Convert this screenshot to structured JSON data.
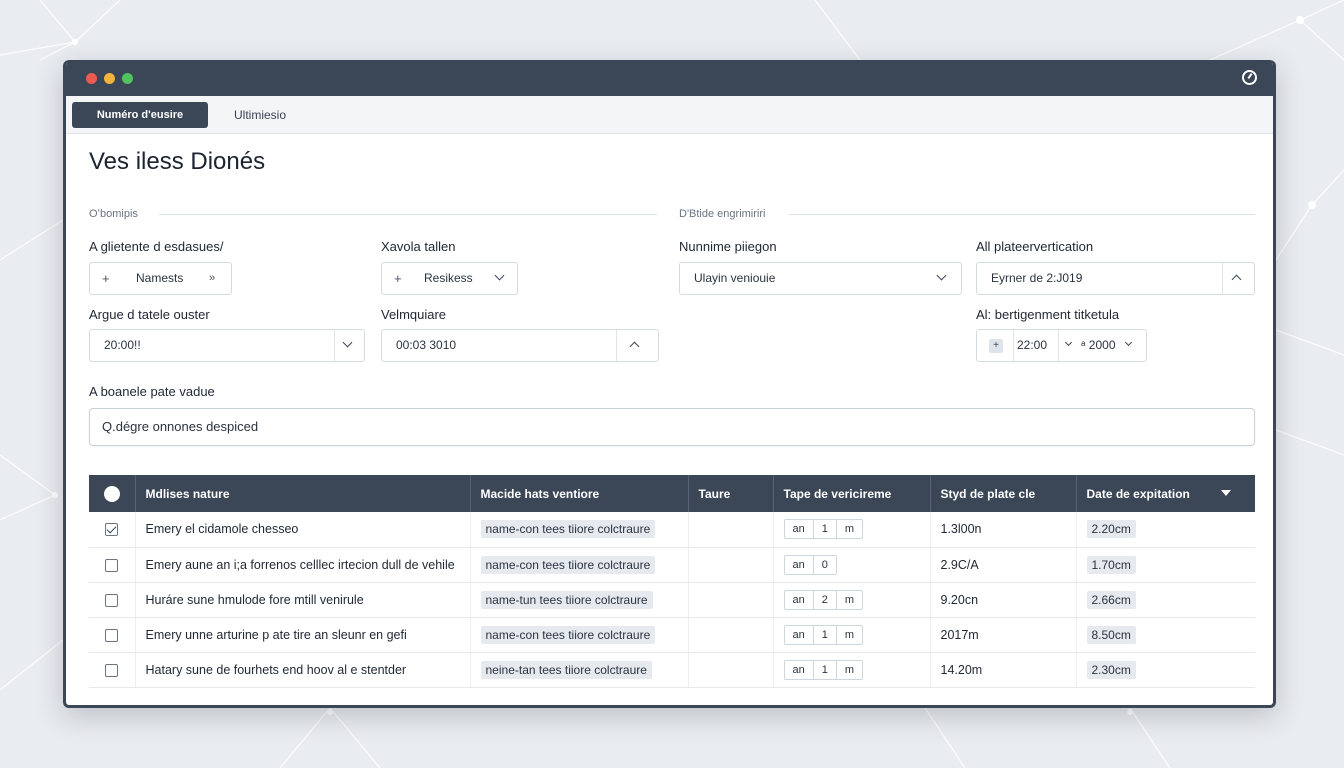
{
  "tabs": [
    {
      "label": "Numéro d'eusire",
      "active": true
    },
    {
      "label": "Ultimiesio",
      "active": false
    }
  ],
  "page_title": "Ves iless Dionés",
  "sections": {
    "left": "Oʻbomipis",
    "right": "D'Btide engrimiriri"
  },
  "fields": {
    "f1": {
      "label": "A glietente d esdasues/",
      "value": "Namests",
      "prefix": "+",
      "suffix": "»"
    },
    "f2": {
      "label": "Xavola tallen",
      "value": "Resikess",
      "prefix": "+"
    },
    "f3": {
      "label": "Nunnime piiegon",
      "value": "Ulayin veniouie"
    },
    "f4": {
      "label": "All plateervertication",
      "value": "Eyrner de 2:J019"
    },
    "f5": {
      "label": "Argue d tatele ouster",
      "value": "20:00!!"
    },
    "f6": {
      "label": "Velmquiare",
      "value": "00:03 3010"
    },
    "f7": {
      "label": "Al: bertigenment titketula",
      "value_a": "22:00",
      "value_b": "ᵃ 2000",
      "prefix": "+"
    }
  },
  "wide": {
    "label": "A boanele pate vadue",
    "value": "Q.dégre onnones despiced"
  },
  "table": {
    "columns": [
      "Mdlises nature",
      "Macide hats ventiore",
      "Taure",
      "Tape de vericireme",
      "Styd de plate cle",
      "Date de expitation"
    ],
    "rows": [
      {
        "checked": true,
        "name": "Emery el cidamole chesseo",
        "desc": "name-con tees tiiore colctraure",
        "step": [
          "an",
          "1",
          "m"
        ],
        "v1": "1.3l00n",
        "v2": "2.20cm"
      },
      {
        "checked": false,
        "name": "Emery aune an i;a forrenos celllec irtecion dull de vehile",
        "desc": "name-con tees tiiore colctraure",
        "step": [
          "an",
          "0"
        ],
        "v1": "2.9C/A",
        "v2": "1.70cm"
      },
      {
        "checked": false,
        "name": "Huráre sune hmulode fore mtill venirule",
        "desc": "name-tun tees tiiore colctraure",
        "step": [
          "an",
          "2",
          "m"
        ],
        "v1": "9.20cn",
        "v2": "2.66cm"
      },
      {
        "checked": false,
        "name": "Emery unne arturine p ate tire an sleunr en gefi",
        "desc": "name-con tees tiiore colctraure",
        "step": [
          "an",
          "1",
          "m"
        ],
        "v1": "2017m",
        "v2": "8.50cm"
      },
      {
        "checked": false,
        "name": "Hatary sune de fourhets end hoov al e stentder",
        "desc": "neine-tan tees tiiore colctraure",
        "step": [
          "an",
          "1",
          "m"
        ],
        "v1": "14.20m",
        "v2": "2.30cm"
      }
    ]
  },
  "colors": {
    "header": "#3b4656",
    "accent_red": "#ec5b4f",
    "accent_yellow": "#f2b33d",
    "accent_green": "#4fc35d"
  }
}
